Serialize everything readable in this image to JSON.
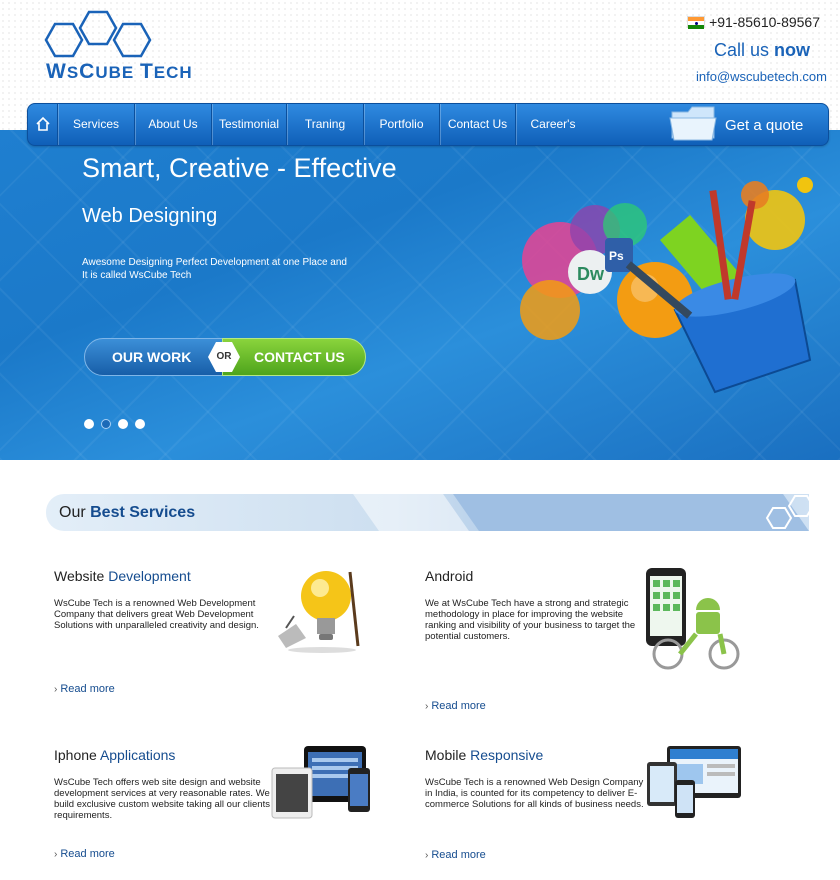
{
  "header": {
    "logo_text_big1": "W",
    "logo_text_small1": "S",
    "logo_text_big2": "C",
    "logo_text_small2": "UBE ",
    "logo_text_big3": "T",
    "logo_text_small3": "ECH",
    "phone": "+91-85610-89567",
    "call_us": "Call us ",
    "call_now": "now",
    "email": "info@wscubetech.com"
  },
  "nav": {
    "items": [
      {
        "label": "Services"
      },
      {
        "label": "About Us"
      },
      {
        "label": "Testimonial"
      },
      {
        "label": "Traning"
      },
      {
        "label": "Portfolio"
      },
      {
        "label": "Contact Us"
      },
      {
        "label": "Career's"
      }
    ],
    "quote": "Get a quote"
  },
  "hero": {
    "title": "Smart, Creative - Effective",
    "subtitle": "Web Designing",
    "description": "Awesome Designing Perfect Development at one Place and It is called WsCube Tech",
    "our_work": "OUR WORK",
    "or": "OR",
    "contact_us": "CONTACT US",
    "slides": 4,
    "active_slide": 2
  },
  "services": {
    "heading_plain": "Our ",
    "heading_bold": "Best Services",
    "items": [
      {
        "title_plain": "Website ",
        "title_hl": "Development",
        "text": "WsCube Tech is a renowned Web Development Company that delivers great Web Development Solutions with unparalleled creativity and design.",
        "more": "Read more"
      },
      {
        "title_plain": "Android",
        "title_hl": "",
        "text": "We at WsCube Tech have a strong and strategic methodology in place for improving the website ranking and visibility of your business to target the potential customers.",
        "more": "Read more"
      },
      {
        "title_plain": "Iphone ",
        "title_hl": "Applications",
        "text": "WsCube Tech offers web site design and website development services at very reasonable rates. We build exclusive custom website taking all our clients requirements.",
        "more": "Read more"
      },
      {
        "title_plain": "Mobile ",
        "title_hl": "Responsive",
        "text": "WsCube Tech is a renowned Web Design Company in India, is counted for its competency to deliver E-commerce Solutions for all kinds of business needs.",
        "more": "Read more"
      }
    ]
  }
}
